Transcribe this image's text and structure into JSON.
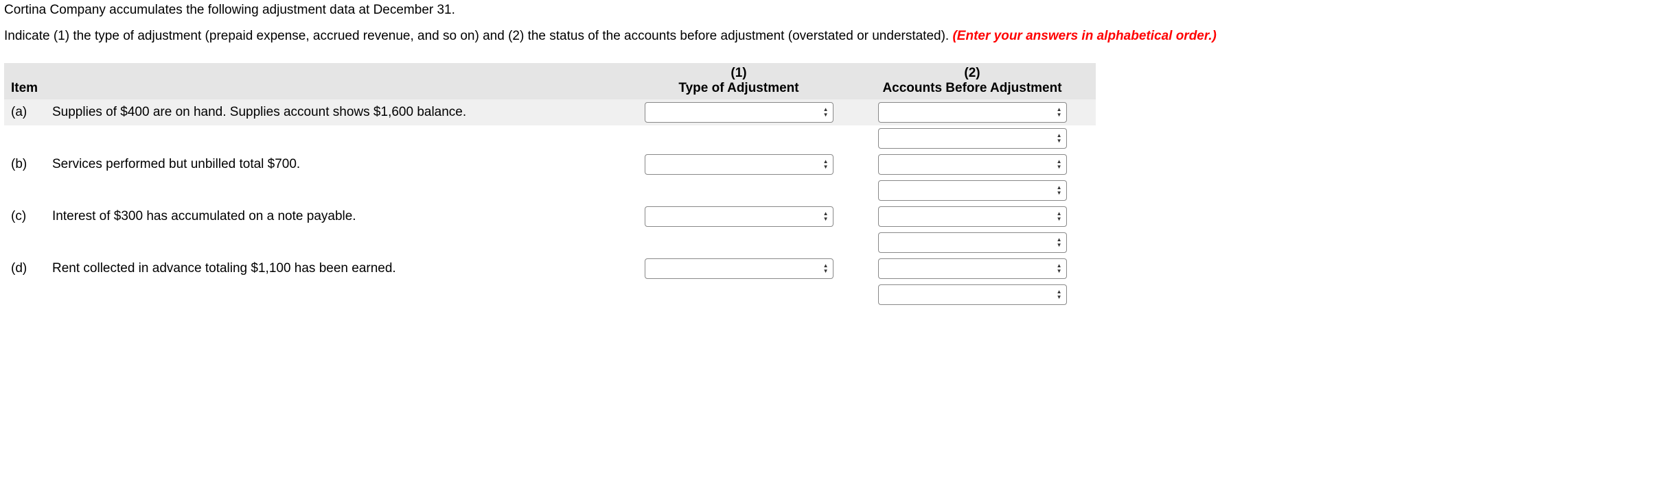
{
  "intro": "Cortina Company accumulates the following adjustment data at December 31.",
  "instruction_prefix": "Indicate (1) the type of adjustment (prepaid expense, accrued revenue, and so on) and (2) the status of the accounts before adjustment (overstated or understated). ",
  "instruction_red": "(Enter your answers in alphabetical order.)",
  "headers": {
    "item": "Item",
    "col1_num": "(1)",
    "col1_label": "Type of Adjustment",
    "col2_num": "(2)",
    "col2_label": "Accounts Before Adjustment"
  },
  "rows": [
    {
      "letter": "(a)",
      "desc": "Supplies of $400 are on hand. Supplies account shows $1,600 balance."
    },
    {
      "letter": "(b)",
      "desc": "Services performed but unbilled total $700."
    },
    {
      "letter": "(c)",
      "desc": "Interest of $300 has accumulated on a note payable."
    },
    {
      "letter": "(d)",
      "desc": "Rent collected in advance totaling $1,100 has been earned."
    }
  ]
}
